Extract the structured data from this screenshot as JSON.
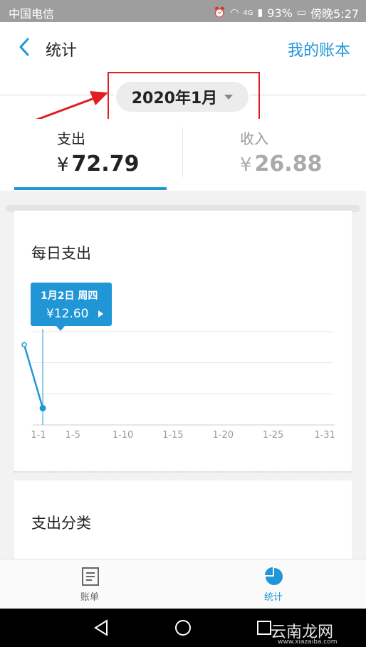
{
  "status_bar": {
    "carrier": "中国电信",
    "battery": "93%",
    "time": "傍晚5:27",
    "network": "4G"
  },
  "header": {
    "title": "统计",
    "ledger_link": "我的账本"
  },
  "month_selector": {
    "label": "2020年1月"
  },
  "tabs": [
    {
      "label": "支出",
      "currency": "¥",
      "amount": "72.79",
      "active": true
    },
    {
      "label": "收入",
      "currency": "¥",
      "amount": "26.88",
      "active": false
    }
  ],
  "daily_card": {
    "title": "每日支出",
    "tooltip": {
      "date": "1月2日 周四",
      "value": "¥12.60"
    }
  },
  "chart_data": {
    "type": "line",
    "title": "每日支出",
    "x_ticks": [
      "1-1",
      "1-5",
      "1-10",
      "1-15",
      "1-20",
      "1-25",
      "1-31"
    ],
    "x_tick_days": [
      1,
      5,
      10,
      15,
      20,
      25,
      31
    ],
    "x": [
      1,
      2
    ],
    "values": [
      60.19,
      12.6
    ],
    "ylim": [
      0,
      70
    ],
    "grid": true,
    "colors": {
      "line": "#2196d6",
      "grid": "#e6e6e6"
    }
  },
  "category_card": {
    "title": "支出分类"
  },
  "bottom_nav": [
    {
      "label": "账单",
      "icon": "bill-icon",
      "active": false
    },
    {
      "label": "统计",
      "icon": "pie-chart-icon",
      "active": true
    }
  ],
  "watermark": {
    "text": "云南龙网",
    "url": "www.xiazaiba.com"
  },
  "colors": {
    "accent": "#2196d6",
    "highlight": "#e02020"
  }
}
